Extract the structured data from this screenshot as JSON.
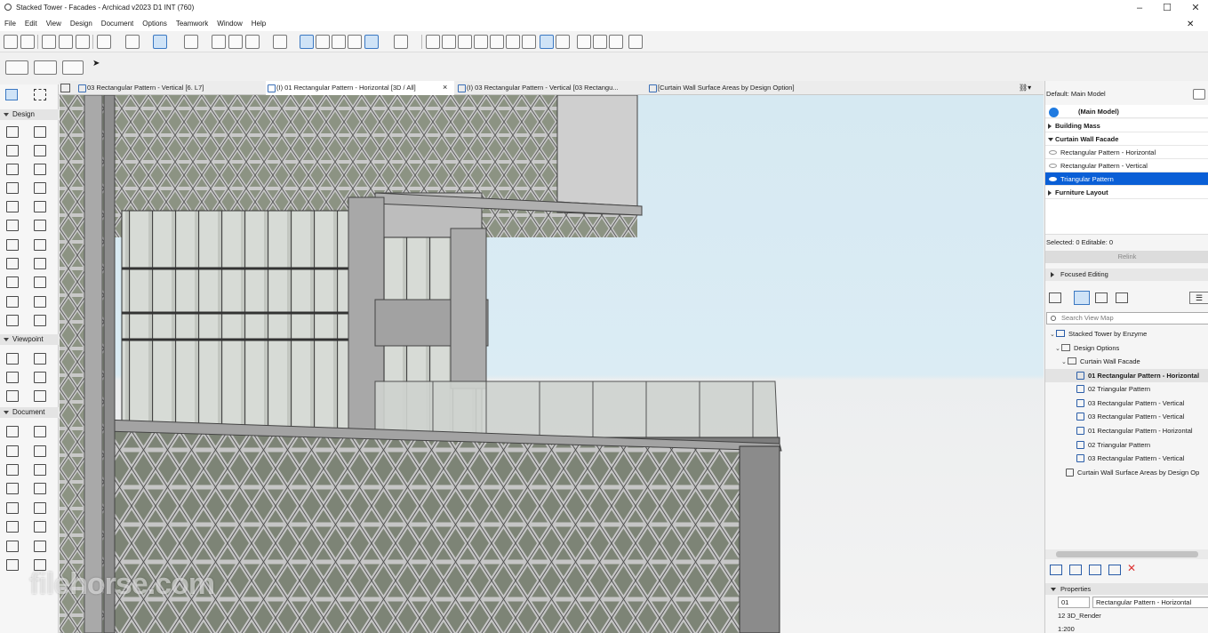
{
  "window": {
    "title": "Stacked Tower - Facades - Archicad v2023 D1 INT (760)",
    "min": "–",
    "max": "☐",
    "close": "✕"
  },
  "menu": [
    "File",
    "Edit",
    "View",
    "Design",
    "Document",
    "Options",
    "Teamwork",
    "Window",
    "Help"
  ],
  "toolbox": {
    "sections": [
      "Design",
      "Viewpoint",
      "Document"
    ]
  },
  "tabs": [
    {
      "label": "03 Rectangular Pattern - Vertical [6. L7]"
    },
    {
      "label": "(I) 01 Rectangular Pattern - Horizontal [3D / All]",
      "close": "×"
    },
    {
      "label": "(I) 03 Rectangular Pattern - Vertical [03 Rectangu..."
    },
    {
      "label": "[Curtain Wall Surface Areas by Design Option]"
    }
  ],
  "design_options": {
    "header": "Default: Main Model",
    "main_model": "(Main Model)",
    "groups": [
      {
        "label": "Building Mass"
      },
      {
        "label": "Curtain Wall Facade"
      }
    ],
    "options": [
      {
        "label": "Rectangular Pattern - Horizontal"
      },
      {
        "label": "Rectangular Pattern - Vertical"
      },
      {
        "label": "Triangular Pattern"
      }
    ],
    "furniture": "Furniture Layout",
    "status": "Selected: 0 Editable: 0",
    "relink": "Relink",
    "focused_editing": "Focused Editing"
  },
  "navigator": {
    "search_placeholder": "Search View Map",
    "root": "Stacked Tower by Enzyme",
    "folder1": "Design Options",
    "folder2": "Curtain Wall Facade",
    "views": [
      "01 Rectangular Pattern - Horizontal",
      "02 Triangular Pattern",
      "03 Rectangular Pattern - Vertical",
      "03 Rectangular Pattern - Vertical",
      "01 Rectangular Pattern - Horizontal",
      "02 Triangular Pattern",
      "03 Rectangular Pattern - Vertical"
    ],
    "schedule": "Curtain Wall Surface Areas by Design Op"
  },
  "properties": {
    "title": "Properties",
    "id": "01",
    "name": "Rectangular Pattern - Horizontal",
    "layer": "12 3D_Render",
    "scale": "1:200"
  },
  "watermark": "filehorse.com"
}
